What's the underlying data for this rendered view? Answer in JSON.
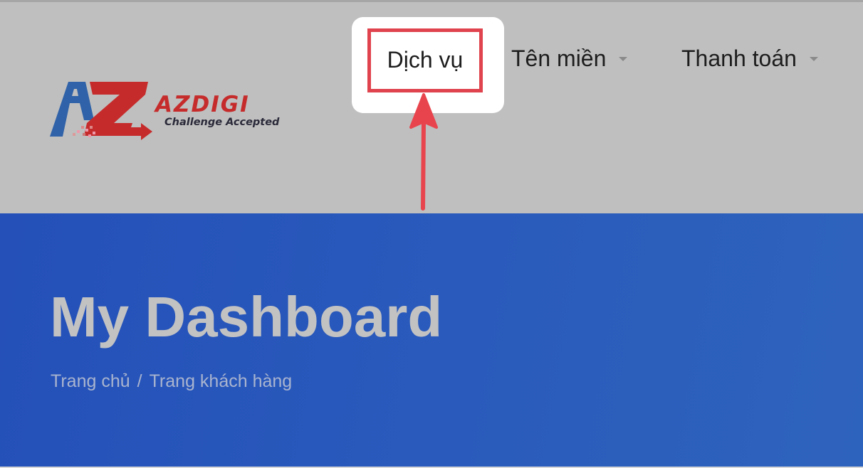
{
  "logo": {
    "brand": "AZDIGI",
    "tagline": "Challenge Accepted"
  },
  "nav": {
    "items": [
      {
        "label": "Dịch vụ",
        "has_dropdown": false,
        "highlighted": true
      },
      {
        "label": "Tên miền",
        "has_dropdown": true
      },
      {
        "label": "Thanh toán",
        "has_dropdown": true
      }
    ]
  },
  "hero": {
    "title": "My Dashboard",
    "breadcrumb": {
      "home": "Trang chủ",
      "separator": "/",
      "current": "Trang khách hàng"
    }
  },
  "colors": {
    "header_bg": "#bfbfbf",
    "hero_bg": "#2a5bbc",
    "highlight_border": "#e0434d",
    "arrow": "#e8444d",
    "logo_blue": "#2f62a8",
    "logo_red": "#c62b2b"
  },
  "annotation": {
    "arrow_icon": "up-arrow-icon"
  }
}
